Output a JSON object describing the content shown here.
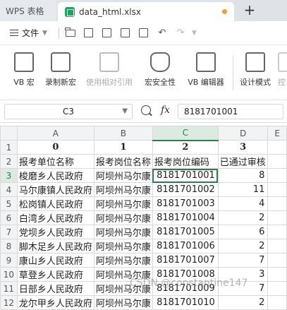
{
  "tabs": {
    "app_label": "WPS 表格",
    "doc_title": "data_html.xlsx",
    "new_tab": "+"
  },
  "menu": {
    "file_label": "文件"
  },
  "ribbon": {
    "buttons": [
      "VB 宏",
      "录制新宏",
      "使用相对引用",
      "宏安全性",
      "VB 编辑器",
      "设计模式",
      "控"
    ]
  },
  "formula_bar": {
    "cell_ref": "C3",
    "fx": "fx",
    "value": "8181701001"
  },
  "sheet": {
    "columns": [
      "A",
      "B",
      "C",
      "D",
      "E"
    ],
    "rows": [
      {
        "n": "1",
        "cells": [
          "0",
          "1",
          "2",
          "3",
          ""
        ]
      },
      {
        "n": "2",
        "cells": [
          "报考单位名称",
          "报考岗位名称",
          "报考岗位编码",
          "已通过审核",
          ""
        ]
      },
      {
        "n": "3",
        "cells": [
          "梭磨乡人民政府",
          "阿坝州马尔康",
          "8181701001",
          "8",
          ""
        ]
      },
      {
        "n": "4",
        "cells": [
          "马尔康镇人民政府",
          "阿坝州马尔康",
          "8181701002",
          "11",
          ""
        ]
      },
      {
        "n": "5",
        "cells": [
          "松岗镇人民政府",
          "阿坝州马尔康",
          "8181701003",
          "4",
          ""
        ]
      },
      {
        "n": "6",
        "cells": [
          "白湾乡人民政府",
          "阿坝州马尔康",
          "8181701004",
          "2",
          ""
        ]
      },
      {
        "n": "7",
        "cells": [
          "党坝乡人民政府",
          "阿坝州马尔康",
          "8181701005",
          "6",
          ""
        ]
      },
      {
        "n": "8",
        "cells": [
          "脚木足乡人民政府",
          "阿坝州马尔康",
          "8181701006",
          "2",
          ""
        ]
      },
      {
        "n": "9",
        "cells": [
          "康山乡人民政府",
          "阿坝州马尔康",
          "8181701007",
          "7",
          ""
        ]
      },
      {
        "n": "10",
        "cells": [
          "草登乡人民政府",
          "阿坝州马尔康",
          "8181701008",
          "3",
          ""
        ]
      },
      {
        "n": "11",
        "cells": [
          "日部乡人民政府",
          "阿坝州马尔康",
          "8181701009",
          "7",
          ""
        ]
      },
      {
        "n": "12",
        "cells": [
          "龙尔甲乡人民政府",
          "阿坝州马尔康",
          "8181701010",
          "2",
          ""
        ]
      }
    ]
  },
  "watermark": "CSDN @constantine147",
  "colors": {
    "accent": "#2e7d4b",
    "xls_green": "#1ea362",
    "unsaved": "#f39c3a"
  }
}
